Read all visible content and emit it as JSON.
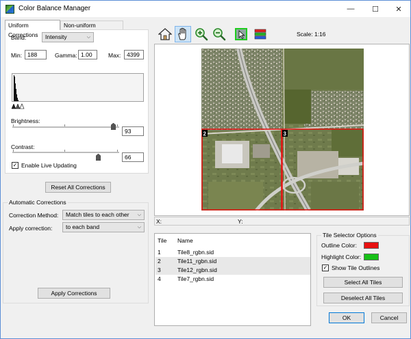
{
  "window": {
    "title": "Color Balance Manager",
    "controls": {
      "minimize": "—",
      "maximize": "☐",
      "close": "✕"
    }
  },
  "tabs": [
    {
      "label": "Uniform Corrections",
      "active": true
    },
    {
      "label": "Non-uniform Corrections",
      "active": false
    }
  ],
  "uniform": {
    "band_label": "Band:",
    "band_value": "Intensity",
    "min_label": "Min:",
    "min_value": "188",
    "gamma_label": "Gamma:",
    "gamma_value": "1.00",
    "max_label": "Max:",
    "max_value": "4399",
    "brightness_label": "Brightness:",
    "brightness_value": "93",
    "contrast_label": "Contrast:",
    "contrast_value": "66",
    "live_update_label": "Enable Live Updating",
    "live_update_checked": true
  },
  "reset_button": "Reset All Corrections",
  "automatic": {
    "group_label": "Automatic Corrections",
    "method_label": "Correction Method:",
    "method_value": "Match tiles to each other",
    "apply_label": "Apply correction:",
    "apply_value": "to each band",
    "apply_button": "Apply Corrections"
  },
  "toolbar": {
    "buttons": [
      {
        "icon": "home-icon"
      },
      {
        "icon": "pan-hand-icon",
        "pressed": true
      },
      {
        "icon": "zoom-in-icon"
      },
      {
        "icon": "zoom-out-icon"
      },
      {
        "icon": "select-tile-icon"
      },
      {
        "icon": "color-bands-icon"
      }
    ],
    "scale_text": "Scale: 1:16"
  },
  "map": {
    "tile_labels": [
      "2",
      "3"
    ]
  },
  "coords": {
    "x_label": "X:",
    "y_label": "Y:"
  },
  "tile_list": {
    "headers": {
      "tile": "Tile",
      "name": "Name"
    },
    "rows": [
      {
        "tile": "1",
        "name": "Tile8_rgbn.sid",
        "selected": false
      },
      {
        "tile": "2",
        "name": "Tile11_rgbn.sid",
        "selected": true
      },
      {
        "tile": "3",
        "name": "Tile12_rgbn.sid",
        "selected": true
      },
      {
        "tile": "4",
        "name": "Tile7_rgbn.sid",
        "selected": false
      }
    ]
  },
  "tile_selector": {
    "group_label": "Tile Selector Options",
    "outline_label": "Outline Color:",
    "outline_color": "#e81010",
    "highlight_label": "Highlight Color:",
    "highlight_color": "#16c016",
    "show_outlines_label": "Show Tile Outlines",
    "show_outlines_checked": true,
    "select_all": "Select All Tiles",
    "deselect_all": "Deselect All Tiles"
  },
  "dialog": {
    "ok": "OK",
    "cancel": "Cancel"
  }
}
